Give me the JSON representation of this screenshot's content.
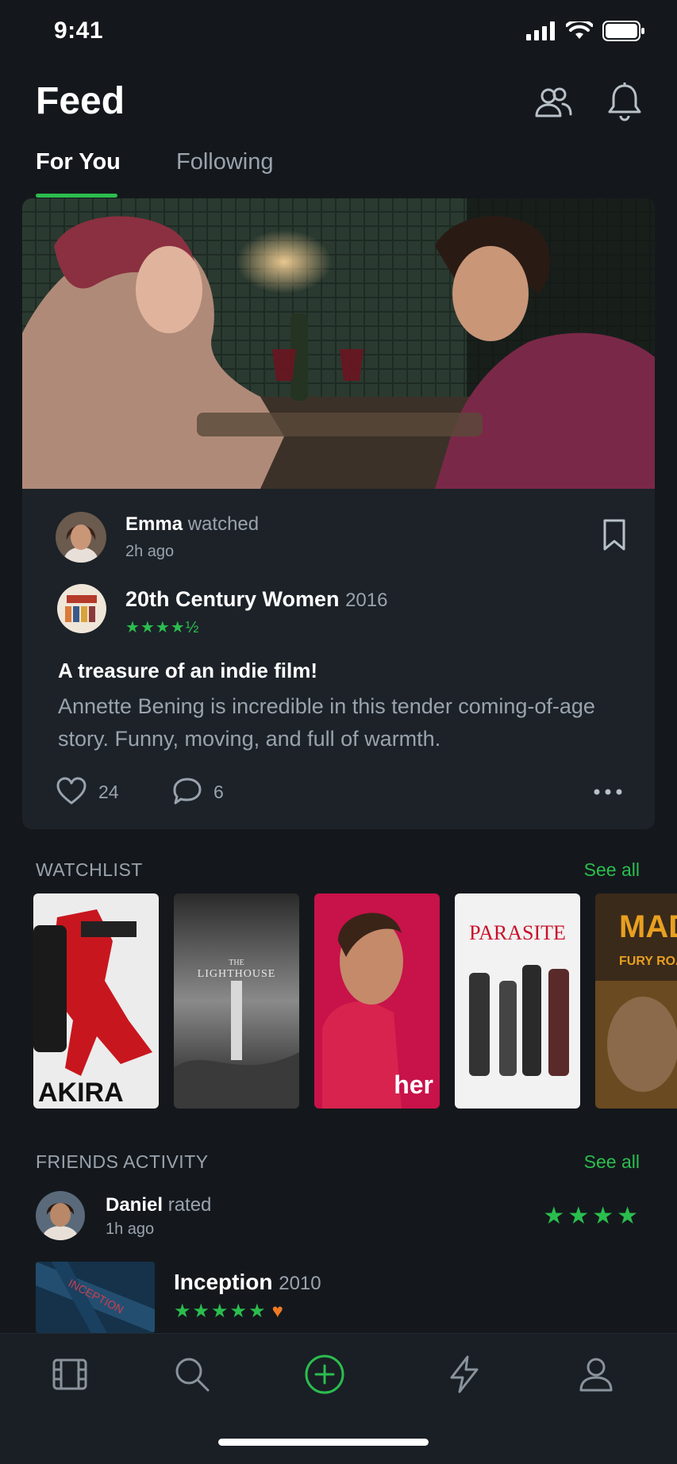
{
  "status_bar": {
    "time": "9:41"
  },
  "header": {
    "title": "Feed"
  },
  "tabs": [
    {
      "label": "For You",
      "active": true
    },
    {
      "label": "Following",
      "active": false
    }
  ],
  "feed_card": {
    "user_name": "Emma",
    "action": "watched",
    "time_ago": "2h ago",
    "film_title": "20th Century Women",
    "film_year": "2016",
    "rating_stars": "★★★★½",
    "rating_value": 4.5,
    "review_title": "A treasure of an indie film!",
    "review_body": "Annette Bening is incredible in this tender coming-of-age story. Funny, moving, and full of warmth.",
    "likes": "24",
    "comments": "6"
  },
  "watchlist": {
    "title": "WATCHLIST",
    "see_all": "See all",
    "posters": [
      {
        "title": "AKIRA"
      },
      {
        "title_top": "THE",
        "title": "LIGHTHOUSE"
      },
      {
        "title": "her"
      },
      {
        "title": "PARASITE"
      },
      {
        "title": "MAD MAX",
        "subtitle": "FURY ROAD"
      }
    ]
  },
  "friends_activity": {
    "title": "FRIENDS ACTIVITY",
    "see_all": "See all",
    "user_name": "Daniel",
    "action": "rated",
    "time_ago": "1h ago",
    "user_rating_stars": "★★★★",
    "user_rating_value": 4,
    "film_title": "Inception",
    "film_year": "2010",
    "film_stars": "★★★★★",
    "liked": true,
    "thumb_text": "INCEPTION"
  },
  "nav": [
    {
      "icon": "film-icon"
    },
    {
      "icon": "search-icon"
    },
    {
      "icon": "add-icon"
    },
    {
      "icon": "activity-icon"
    },
    {
      "icon": "profile-icon"
    }
  ],
  "colors": {
    "background": "#14181c",
    "accent": "#2bbd4e",
    "muted": "#9aa3ad",
    "heart": "#f07a24"
  }
}
